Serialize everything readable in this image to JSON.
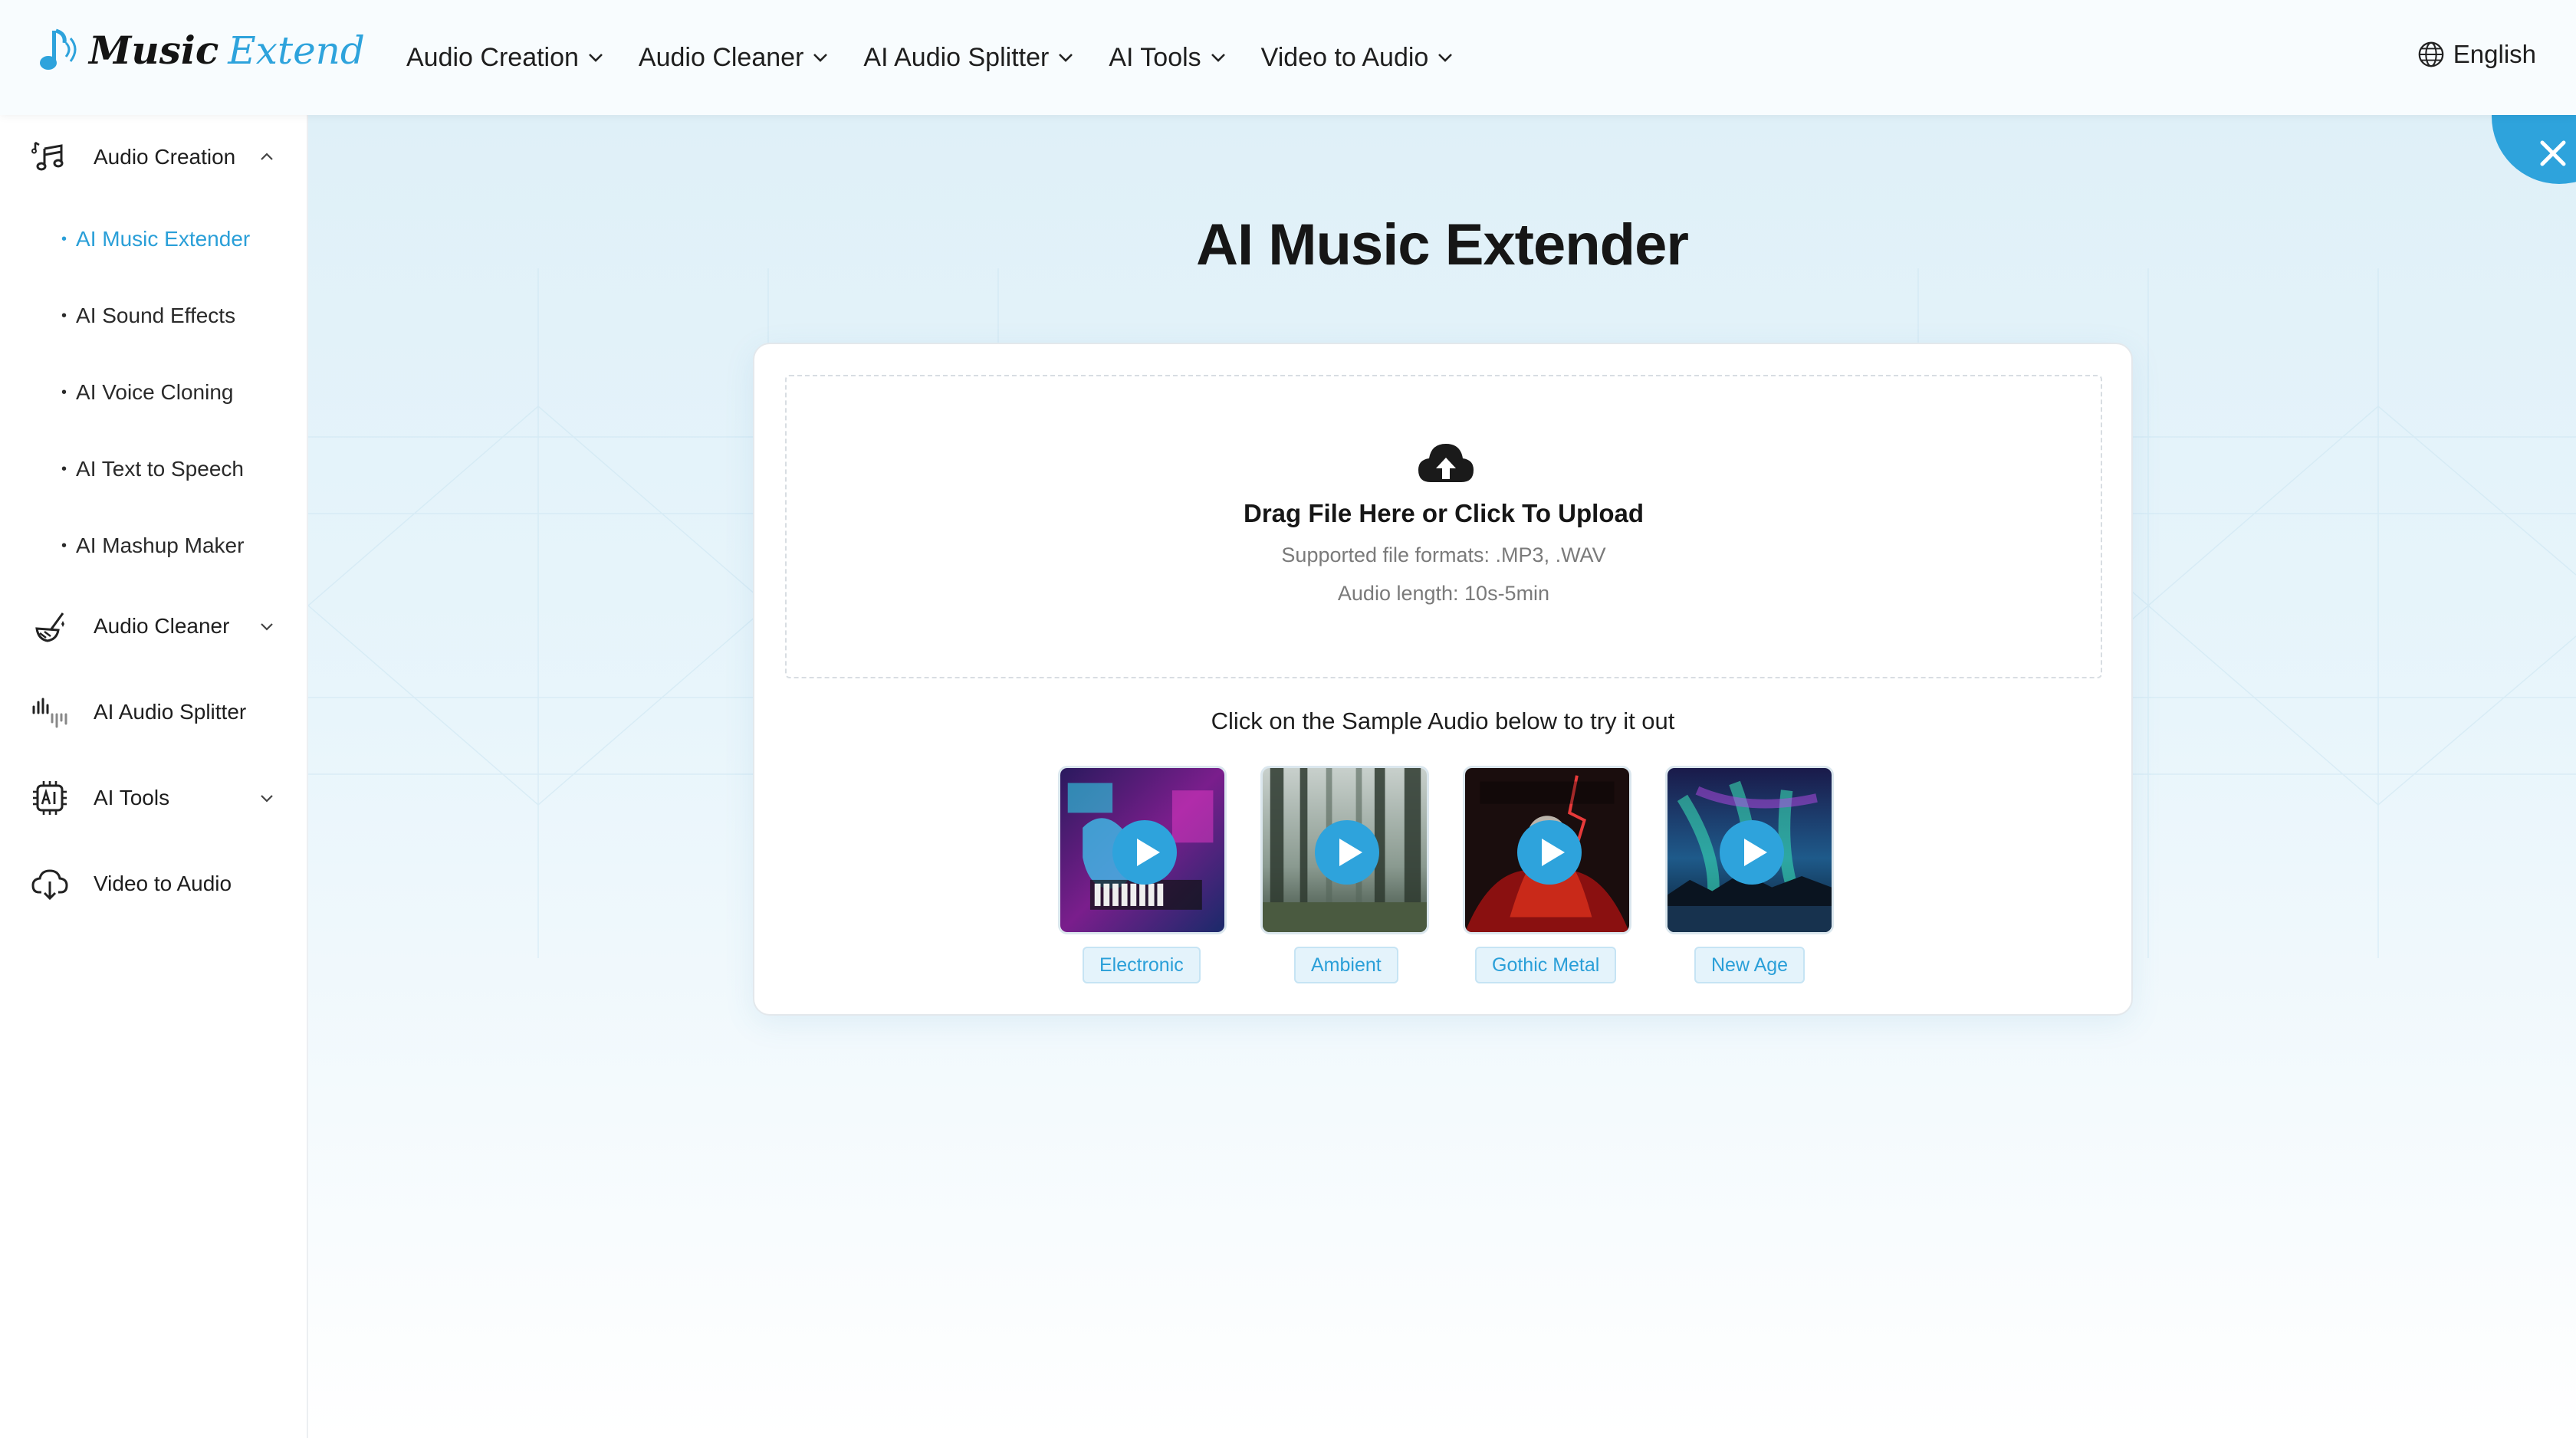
{
  "brand": {
    "word1": "Music",
    "word2": "Extend",
    "accent": "#2ea3dc"
  },
  "topnav": {
    "items": [
      {
        "label": "Audio Creation"
      },
      {
        "label": "Audio Cleaner"
      },
      {
        "label": "AI Audio Splitter"
      },
      {
        "label": "AI Tools"
      },
      {
        "label": "Video to Audio"
      }
    ],
    "language": "English"
  },
  "sidebar": {
    "items": [
      {
        "label": "Audio Creation",
        "icon": "music-notes-icon",
        "expanded": true
      },
      {
        "label": "Audio Cleaner",
        "icon": "broom-icon",
        "expanded": false
      },
      {
        "label": "AI Audio Splitter",
        "icon": "waveform-icon"
      },
      {
        "label": "AI Tools",
        "icon": "ai-chip-icon",
        "expanded": false
      },
      {
        "label": "Video to Audio",
        "icon": "cloud-download-icon"
      }
    ],
    "subitems": [
      {
        "label": "AI Music Extender",
        "active": true
      },
      {
        "label": "AI Sound Effects"
      },
      {
        "label": "AI Voice Cloning"
      },
      {
        "label": "AI Text to Speech"
      },
      {
        "label": "AI Mashup Maker"
      }
    ]
  },
  "main": {
    "title": "AI Music Extender",
    "upload": {
      "title": "Drag File Here or Click To Upload",
      "formats": "Supported file formats:  .MP3, .WAV",
      "length": "Audio length: 10s-5min",
      "icon": "cloud-upload-icon"
    },
    "sample_hint": "Click on the Sample Audio below to try it out",
    "samples": [
      {
        "label": "Electronic"
      },
      {
        "label": "Ambient"
      },
      {
        "label": "Gothic Metal"
      },
      {
        "label": "New Age"
      }
    ]
  }
}
